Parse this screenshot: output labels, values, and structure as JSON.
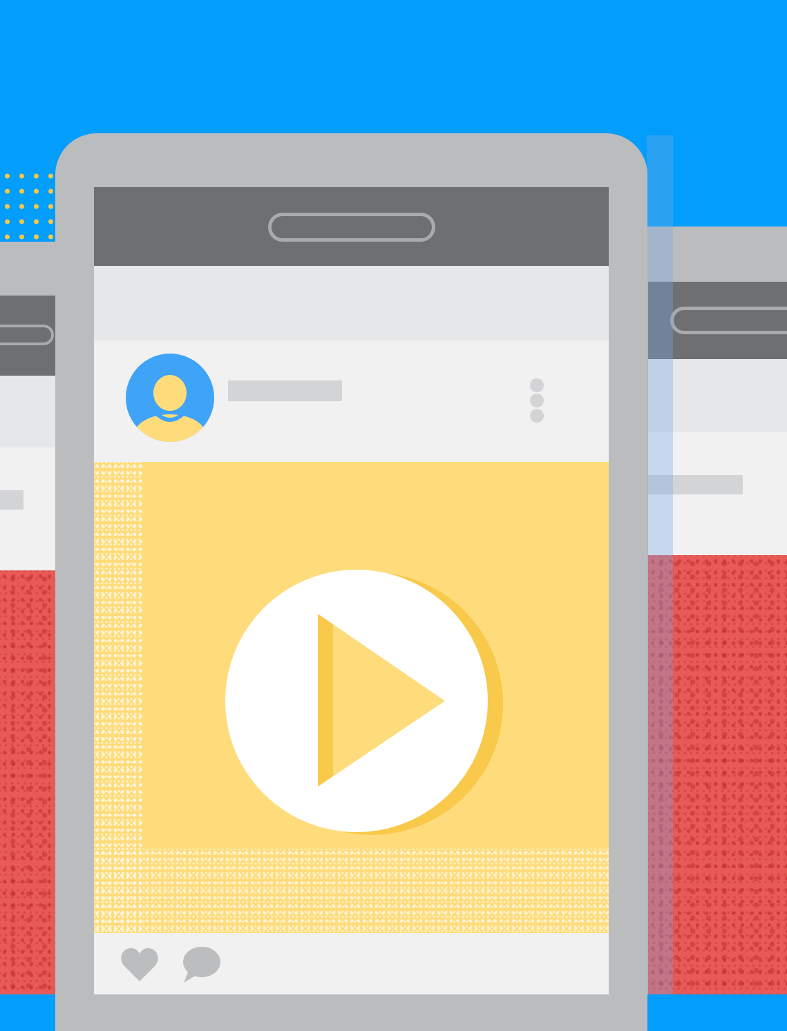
{
  "scene": {
    "background_color": "#039dfb",
    "accent_yellow": "#fedc7b",
    "accent_red": "#e85a55",
    "device_frame_color": "#bbbcbe"
  },
  "front_phone": {
    "avatar_icon": "user-avatar-icon",
    "menu_icon": "more-vert-icon",
    "media_icon": "play-icon",
    "actions": [
      {
        "icon": "heart-icon"
      },
      {
        "icon": "comment-icon"
      }
    ]
  }
}
